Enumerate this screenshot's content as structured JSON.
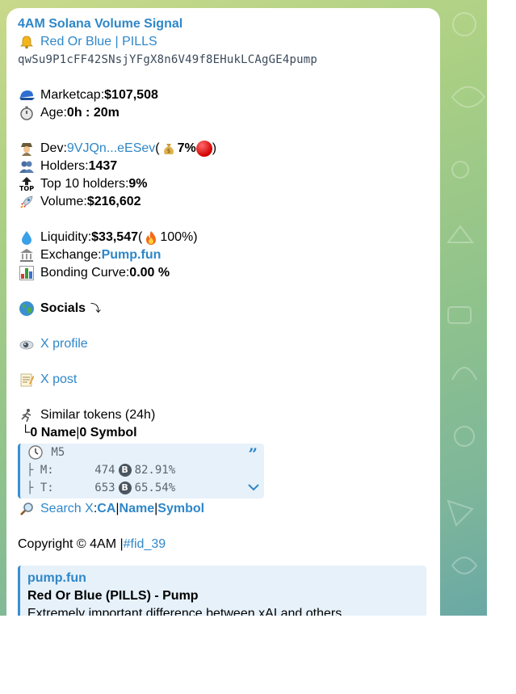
{
  "message": {
    "channel_title": "4AM Solana Volume Signal",
    "token_line": "Red Or Blue | PILLS",
    "contract": "qwSu9P1cFF42SNsjYFgX8n6V49f8EHukLCAgGE4pump",
    "marketcap_label": "Marketcap: ",
    "marketcap_value": "$107,508",
    "age_label": "Age: ",
    "age_value": "0h : 20m",
    "dev_label": "Dev: ",
    "dev_link": "9VJQn...eESev",
    "dev_open": " (",
    "dev_pct": " 7% ",
    "dev_close": ")",
    "holders_label": "Holders: ",
    "holders_value": "1437",
    "top10_label": "Top 10 holders: ",
    "top10_value": "9%",
    "volume_label": "Volume: ",
    "volume_value": "$216,602",
    "liquidity_label": "Liquidity: ",
    "liquidity_value": "$33,547",
    "liquidity_open": " (",
    "liquidity_pct": " 100%)",
    "exchange_label": "Exchange: ",
    "exchange_value": "Pump.fun",
    "bonding_label": "Bonding Curve: ",
    "bonding_value": "0.00 %",
    "socials_label": "Socials",
    "socials_arrow": "⤵",
    "x_profile": "X profile",
    "x_post": "X post",
    "similar_label": "Similar tokens (24h)",
    "similar_prefix": "└",
    "similar_name": "0 Name",
    "similar_sep": " |  ",
    "similar_symbol": "0 Symbol",
    "quote": {
      "header": " M5",
      "row1_prefix": "├ M:      474",
      "row1_icon": "B",
      "row1_value": "82.91%",
      "row2_prefix": "├ T:      653",
      "row2_icon": "B",
      "row2_value": "65.54%"
    },
    "search_link": "Search X",
    "search_colon": ": ",
    "search_ca": "CA",
    "search_sep1": " | ",
    "search_name": "Name",
    "search_sep2": " | ",
    "search_symbol": "Symbol",
    "copyright": "Copyright © 4AM | ",
    "hashtag": "#fid_39",
    "preview": {
      "site": "pump.fun",
      "title": "Red Or Blue (PILLS) - Pump",
      "description": "Extremely important difference between xAI and others"
    }
  },
  "icons": {
    "bell": "bell-icon",
    "cap": "cap-icon",
    "stopwatch": "stopwatch-icon",
    "dev": "detective-icon",
    "holders": "people-icon",
    "top": "top-arrow-icon",
    "rocket": "rocket-icon",
    "droplet": "droplet-icon",
    "bank": "bank-icon",
    "chart": "bar-chart-icon",
    "globe": "globe-icon",
    "eye": "eye-icon",
    "memo": "memo-icon",
    "runner": "runner-icon",
    "magnifier": "magnifier-icon"
  },
  "colors": {
    "link": "#2f87c8",
    "quote_bg": "#e6f1fa",
    "quote_border": "#3a8fd0"
  }
}
